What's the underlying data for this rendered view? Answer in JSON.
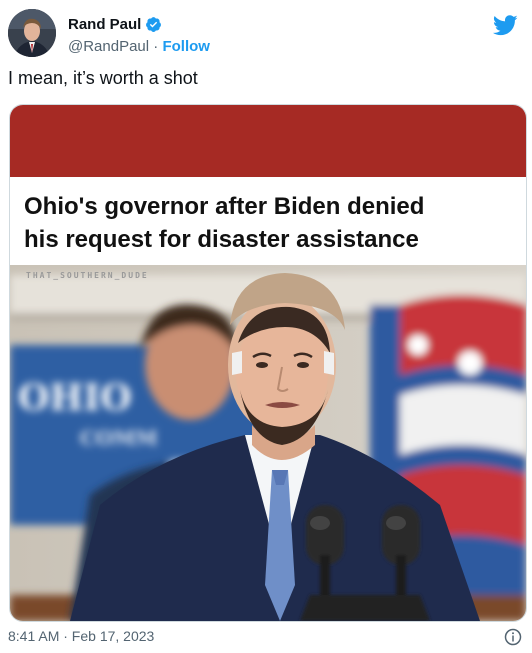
{
  "author": {
    "name": "Rand Paul",
    "handle": "@RandPaul",
    "separator": "·",
    "follow_label": "Follow"
  },
  "tweet": {
    "text": "I mean, it’s worth a shot",
    "timestamp": "8:41 AM · Feb 17, 2023"
  },
  "media": {
    "headline_line1": "Ohio's governor after Biden denied",
    "headline_line2": "his request for disaster assistance",
    "watermark": "THAT_SOUTHERN_DUDE",
    "sign_text": "OHIO",
    "sign_text2": "COMM"
  },
  "colors": {
    "accent": "#1d9bf0",
    "banner_red": "#a62a24",
    "secondary_text": "#536471"
  },
  "icons": [
    "verified-badge-icon",
    "twitter-bird-icon",
    "info-icon"
  ]
}
